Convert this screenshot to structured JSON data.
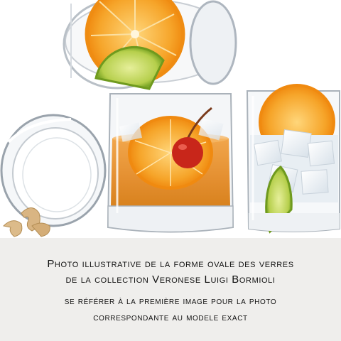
{
  "caption": {
    "line1": "Photo illustrative de la forme ovale des verres",
    "line2": "de la collection Veronese Luigi Bormioli",
    "line3": "se référer à la première image pour la photo",
    "line4": "correspondante au modele exact"
  },
  "photo": {
    "subject": "glass-tumblers-with-citrus",
    "colors": {
      "background": "#ffffff",
      "caption_background": "#efeeec",
      "drink": "#e8973a",
      "orange": "#f3a52d",
      "lime": "#b7cf4d",
      "cherry": "#c8261a",
      "cashew": "#d9b583"
    }
  }
}
